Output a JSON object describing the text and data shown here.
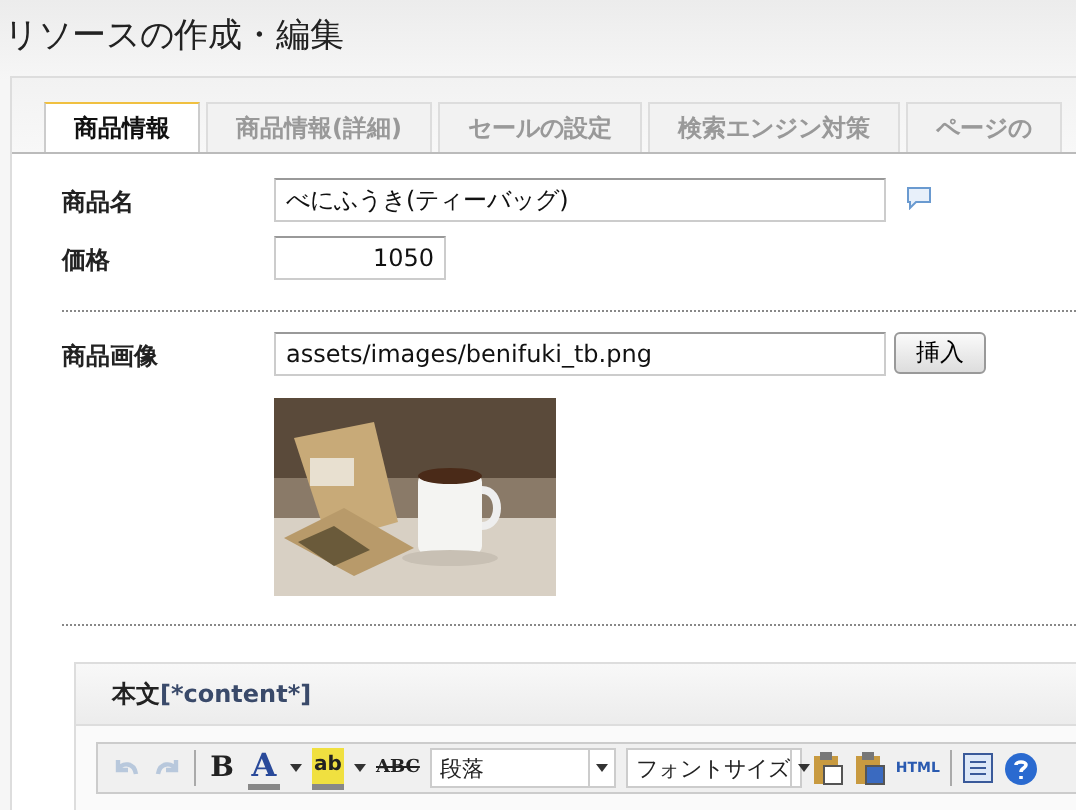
{
  "title": "リソースの作成・編集",
  "tabs": [
    {
      "label": "商品情報",
      "selected": true
    },
    {
      "label": "商品情報(詳細)",
      "selected": false
    },
    {
      "label": "セールの設定",
      "selected": false
    },
    {
      "label": "検索エンジン対策",
      "selected": false
    },
    {
      "label": "ページの",
      "selected": false
    }
  ],
  "fields": [
    {
      "label": "商品名",
      "value": "べにふうき(ティーバッグ)",
      "kind": "text"
    },
    {
      "label": "価格",
      "value": "1050",
      "kind": "number"
    }
  ],
  "image_field": {
    "label": "商品画像",
    "value": "assets/images/benifuki_tb.png",
    "button": "挿入"
  },
  "editor": {
    "label": "本文",
    "tag": "[*content*]",
    "toolbar": [
      {
        "kind": "undo",
        "disabled": true
      },
      {
        "kind": "redo",
        "disabled": true
      },
      {
        "kind": "sep"
      },
      {
        "kind": "bold",
        "text": "B"
      },
      {
        "kind": "color",
        "text": "A"
      },
      {
        "kind": "highlight",
        "text": "ab"
      },
      {
        "kind": "strike",
        "text": "ABC"
      },
      {
        "kind": "select",
        "text": "段落"
      },
      {
        "kind": "select",
        "text": "フォントサイズ"
      },
      {
        "kind": "paste-text"
      },
      {
        "kind": "paste-word"
      },
      {
        "kind": "html",
        "text": "HTML"
      },
      {
        "kind": "sep"
      },
      {
        "kind": "list"
      },
      {
        "kind": "help"
      }
    ]
  }
}
